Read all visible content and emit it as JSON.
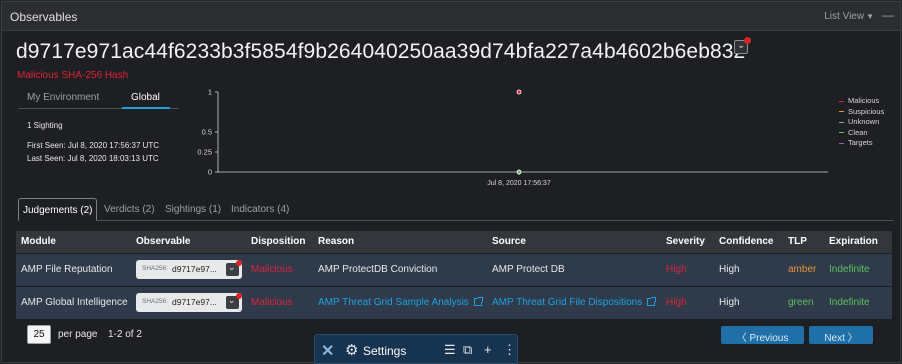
{
  "header": {
    "title": "Observables",
    "view_label": "List View",
    "minimize": "—"
  },
  "observable": {
    "hash": "d9717e971ac44f6233b3f5854f9b264040250aa39d74bfa227a4b4602b6eb832",
    "subtitle": "Malicious SHA-256 Hash"
  },
  "env_tabs": {
    "my_environment": "My Environment",
    "global": "Global",
    "active": "Global"
  },
  "sightings": {
    "count": "1 Sighting",
    "first_seen": "First Seen: Jul 8, 2020 17:56:37 UTC",
    "last_seen": "Last Seen: Jul 8, 2020 18:03:13 UTC"
  },
  "chart_data": {
    "type": "scatter",
    "y_ticks": [
      "1",
      "0.5",
      "0.25",
      "0"
    ],
    "ylim": [
      0,
      1
    ],
    "x_tick_labels": [
      "Jul 8, 2020 17:56:37"
    ],
    "points": [
      {
        "series": "Malicious",
        "x": "Jul 8, 2020 17:56:37",
        "y": 1
      },
      {
        "series": "Clean",
        "x": "Jul 8, 2020 17:56:37",
        "y": 0
      }
    ],
    "legend": [
      {
        "name": "Malicious",
        "color": "#e0223a"
      },
      {
        "name": "Suspicious",
        "color": "#f0932b"
      },
      {
        "name": "Unknown",
        "color": "#9aa0a6"
      },
      {
        "name": "Clean",
        "color": "#5cc25c"
      },
      {
        "name": "Targets",
        "color": "#9b59d0"
      }
    ],
    "legend_position": "right"
  },
  "tabs": [
    {
      "label": "Judgements (2)",
      "active": true
    },
    {
      "label": "Verdicts (2)"
    },
    {
      "label": "Sightings (1)"
    },
    {
      "label": "Indicators (4)"
    }
  ],
  "table": {
    "columns": [
      "Module",
      "Observable",
      "Disposition",
      "Reason",
      "Source",
      "Severity",
      "Confidence",
      "TLP",
      "Expiration"
    ],
    "rows": [
      {
        "module": "AMP File Reputation",
        "obs_type": "SHA256:",
        "obs_value": "d9717e97...",
        "disposition": "Malicious",
        "reason": "AMP ProtectDB Conviction",
        "source": "AMP Protect DB",
        "severity": "High",
        "confidence": "High",
        "tlp": "amber",
        "expiration": "Indefinite"
      },
      {
        "module": "AMP Global Intelligence",
        "obs_type": "SHA256:",
        "obs_value": "d9717e97...",
        "disposition": "Malicious",
        "reason": "AMP Threat Grid Sample Analysis",
        "source": "AMP Threat Grid File Dispositions",
        "severity": "High",
        "confidence": "High",
        "tlp": "green",
        "expiration": "Indefinite"
      }
    ]
  },
  "pagination": {
    "per_page_value": "25",
    "per_page_label": "per page",
    "range": "1-2 of 2",
    "previous": "Previous",
    "next": "Next"
  },
  "dock": {
    "label": "Settings"
  },
  "colors": {
    "accent": "#1ba3e0",
    "malicious": "#e0223a",
    "amber": "#f0932b",
    "green": "#5cc25c",
    "row_bg": "#2f3a4b"
  }
}
